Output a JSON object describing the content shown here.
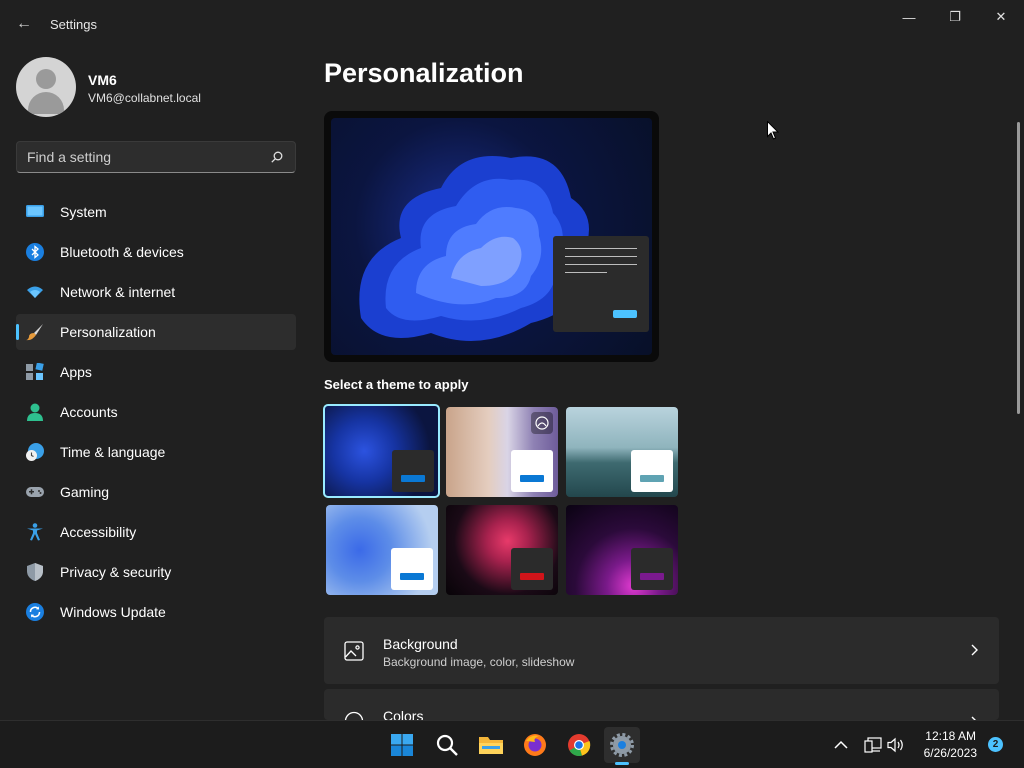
{
  "window": {
    "title": "Settings",
    "back_glyph": "←",
    "minimize_glyph": "—",
    "maximize_glyph": "❐",
    "close_glyph": "✕"
  },
  "profile": {
    "name": "VM6",
    "email": "VM6@collabnet.local"
  },
  "search": {
    "placeholder": "Find a setting",
    "value": ""
  },
  "nav": {
    "items": [
      {
        "label": "System",
        "icon": "system-icon"
      },
      {
        "label": "Bluetooth & devices",
        "icon": "bluetooth-icon"
      },
      {
        "label": "Network & internet",
        "icon": "wifi-icon"
      },
      {
        "label": "Personalization",
        "icon": "brush-icon",
        "active": true
      },
      {
        "label": "Apps",
        "icon": "apps-icon"
      },
      {
        "label": "Accounts",
        "icon": "account-icon"
      },
      {
        "label": "Time & language",
        "icon": "clock-globe-icon"
      },
      {
        "label": "Gaming",
        "icon": "gamepad-icon"
      },
      {
        "label": "Accessibility",
        "icon": "accessibility-icon"
      },
      {
        "label": "Privacy & security",
        "icon": "shield-icon"
      },
      {
        "label": "Windows Update",
        "icon": "update-icon"
      }
    ]
  },
  "main": {
    "title": "Personalization",
    "themes_label": "Select a theme to apply",
    "themes": [
      {
        "name": "theme-windows-dark",
        "accent": "#0a78d4",
        "mini_bg": "#2b2b2b",
        "selected": true
      },
      {
        "name": "theme-glow",
        "accent": "#0a78d4",
        "mini_bg": "#ffffff",
        "badge": "contrast-icon"
      },
      {
        "name": "theme-captured-motion",
        "accent": "#5fa3b3",
        "mini_bg": "#ffffff"
      },
      {
        "name": "theme-windows-light",
        "accent": "#0a78d4",
        "mini_bg": "#ffffff"
      },
      {
        "name": "theme-flow",
        "accent": "#d1141a",
        "mini_bg": "#2b2b2b"
      },
      {
        "name": "theme-sunrise",
        "accent": "#7b1a8e",
        "mini_bg": "#2b2b2b"
      }
    ],
    "cards": [
      {
        "title": "Background",
        "subtitle": "Background image, color, slideshow",
        "icon": "image-icon"
      },
      {
        "title": "Colors",
        "subtitle": "",
        "icon": "palette-icon"
      }
    ]
  },
  "taskbar": {
    "apps": [
      "start-icon",
      "search-icon",
      "file-explorer-icon",
      "firefox-icon",
      "chrome-icon",
      "settings-icon"
    ],
    "active_app": "settings-icon",
    "clock": {
      "time": "12:18 AM",
      "date": "6/26/2023"
    },
    "notification_count": "2"
  },
  "colors": {
    "accent": "#4cc2ff",
    "background": "#202020",
    "card": "#2b2b2b"
  }
}
